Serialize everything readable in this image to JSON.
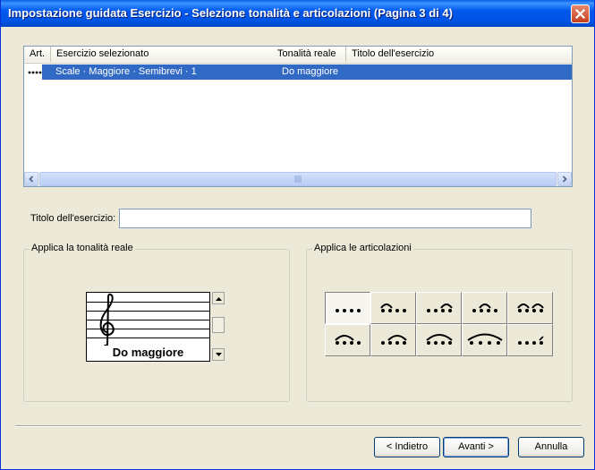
{
  "window": {
    "title": "Impostazione guidata Esercizio - Selezione tonalità e articolazioni (Pagina 3 di 4)"
  },
  "table": {
    "columns": [
      "Art.",
      "Esercizio selezionato",
      "Tonalità reale",
      "Titolo dell'esercizio"
    ],
    "rows": [
      {
        "art_icon": "four-quarter-dots-icon",
        "esercizio": "Scale  · Maggiore  · Semibrevi · 1",
        "tonalita": "Do maggiore",
        "titolo": ""
      }
    ],
    "selected_row": 0
  },
  "title_field": {
    "label": "Titolo dell'esercizio:",
    "value": ""
  },
  "tonality_group": {
    "label": "Applica la tonalità reale",
    "key_name": "Do maggiore"
  },
  "articulation_group": {
    "label": "Applica le articolazioni",
    "patterns": [
      "four-dots",
      "slur-two-dots",
      "slur-last-two",
      "slur-middle-two",
      "slur-pairs",
      "slur-first-three",
      "slur-last-three",
      "slur-all-four",
      "slur-long",
      "dots-with-accent"
    ],
    "selected_index": 0
  },
  "buttons": {
    "back": "< Indietro",
    "next": "Avanti >",
    "cancel": "Annulla"
  },
  "colors": {
    "titlebar": "#0054e3",
    "selection": "#316ac5",
    "window_bg": "#ece9d8"
  }
}
